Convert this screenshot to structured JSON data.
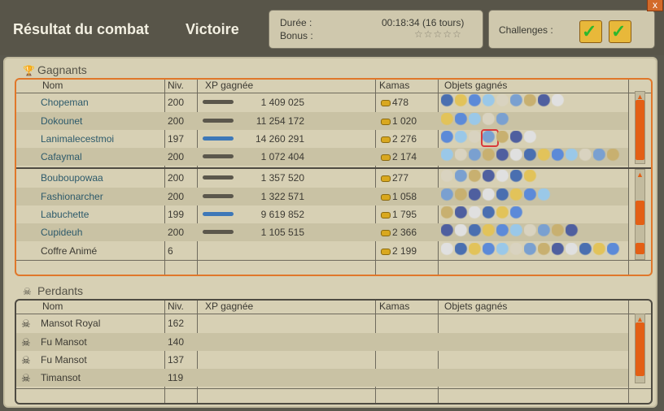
{
  "header": {
    "title": "Résultat du combat",
    "outcome": "Victoire",
    "duration_label": "Durée :",
    "duration_value": "00:18:34 (16 tours)",
    "bonus_label": "Bonus :",
    "bonus_stars": "☆☆☆☆☆",
    "challenges_label": "Challenges :",
    "close_glyph": "x"
  },
  "winners": {
    "title": "Gagnants",
    "columns": [
      "Nom",
      "Niv.",
      "XP gagnée",
      "Kamas",
      "Objets gagnés"
    ],
    "rows": [
      {
        "name": "Chopeman",
        "level": "200",
        "xp": "1 409 025",
        "kamas": "478",
        "bar": "grey"
      },
      {
        "name": "Dokounet",
        "level": "200",
        "xp": "11 254 172",
        "kamas": "1 020",
        "bar": "grey"
      },
      {
        "name": "Lanimalecestmoi",
        "level": "197",
        "xp": "14 260 291",
        "kamas": "2 276",
        "bar": "blue"
      },
      {
        "name": "Cafaymal",
        "level": "200",
        "xp": "1 072 404",
        "kamas": "2 174",
        "bar": "grey"
      },
      {
        "name": "Bouboupowaa",
        "level": "200",
        "xp": "1 357 520",
        "kamas": "277",
        "bar": "grey"
      },
      {
        "name": "Fashionarcher",
        "level": "200",
        "xp": "1 322 571",
        "kamas": "1 058",
        "bar": "grey"
      },
      {
        "name": "Labuchette",
        "level": "199",
        "xp": "9 619 852",
        "kamas": "1 795",
        "bar": "blue"
      },
      {
        "name": "Cupideuh",
        "level": "200",
        "xp": "1 105 515",
        "kamas": "2 366",
        "bar": "grey"
      },
      {
        "name": "Coffre Animé",
        "level": "6",
        "xp": "",
        "kamas": "2 199",
        "bar": "none"
      }
    ]
  },
  "losers": {
    "title": "Perdants",
    "columns": [
      "Nom",
      "Niv.",
      "XP gagnée",
      "Kamas",
      "Objets gagnés"
    ],
    "rows": [
      {
        "name": "Mansot Royal",
        "level": "162"
      },
      {
        "name": "Fu Mansot",
        "level": "140"
      },
      {
        "name": "Fu Mansot",
        "level": "137"
      },
      {
        "name": "Timansot",
        "level": "119"
      }
    ]
  },
  "colors": {
    "accent_orange": "#e0772a",
    "panel_bg": "#d7d0b4",
    "player_name": "#2d5a6b",
    "challenge_check": "#2db82d"
  },
  "icons": [
    "trophy-icon",
    "skull-icon",
    "coin-icon",
    "challenge-icon",
    "close-icon",
    "loot-item-icon"
  ]
}
